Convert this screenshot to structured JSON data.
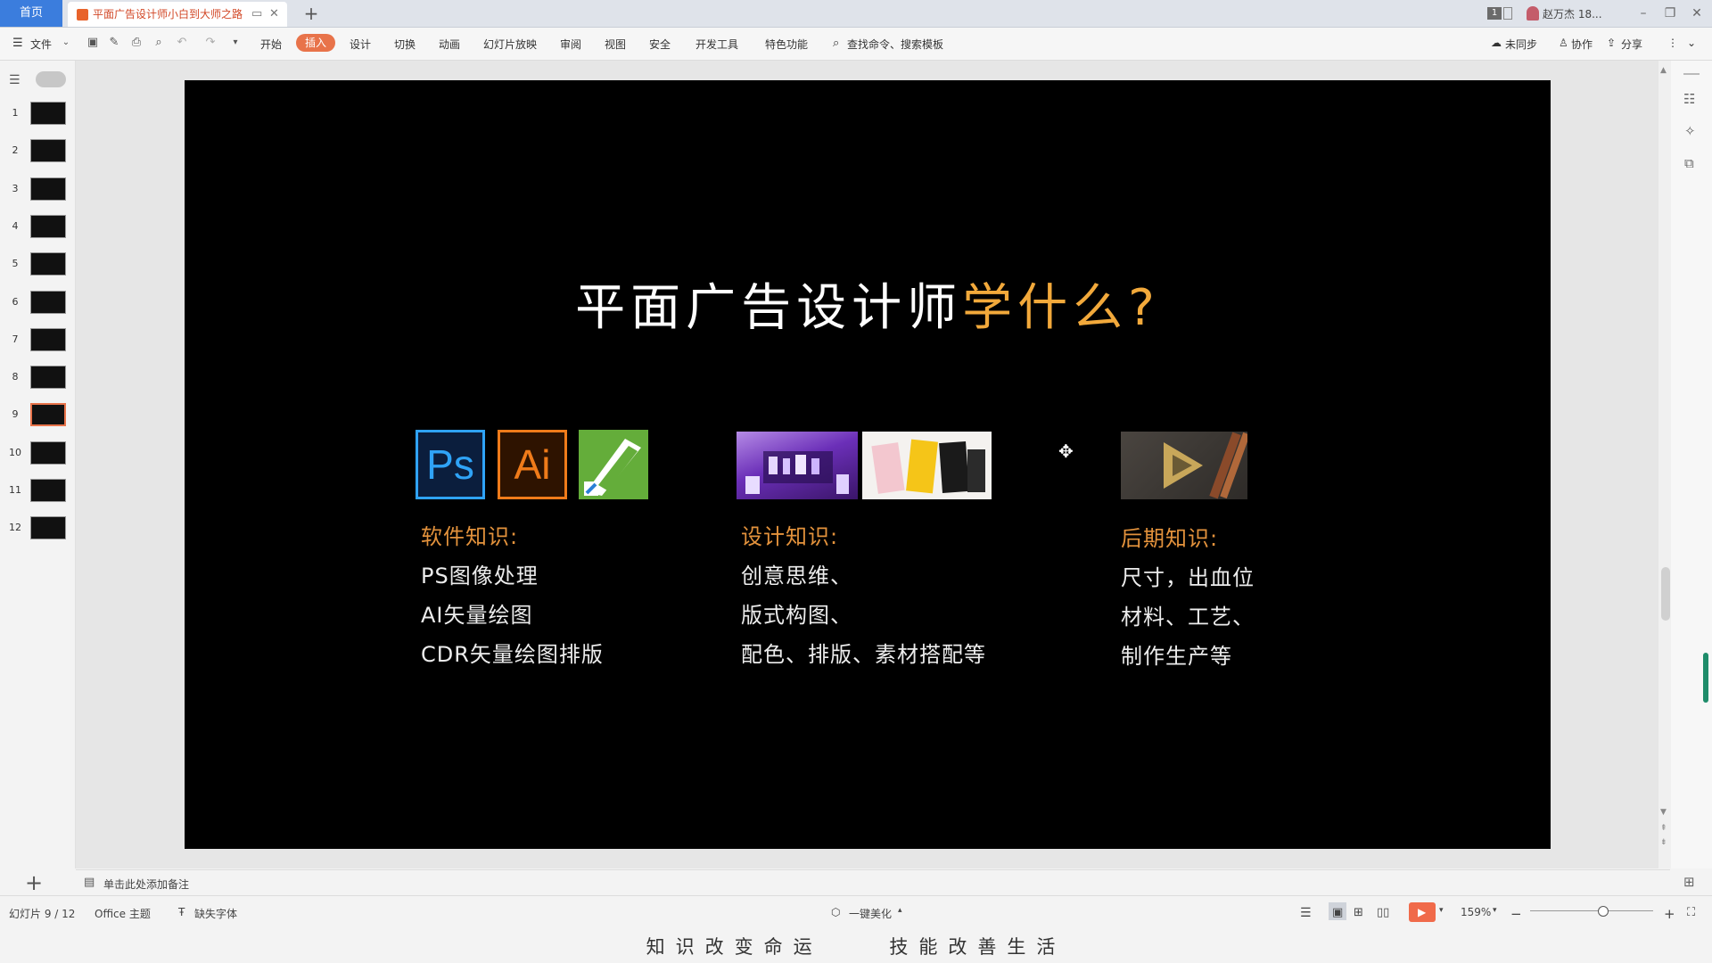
{
  "tabs": {
    "home": "首页",
    "doc_title": "平面广告设计师小白到大师之路",
    "add": "+"
  },
  "titlebar": {
    "page_badge": "1",
    "user_name": "赵万杰 18..."
  },
  "ribbon": {
    "file": "文件",
    "menus": [
      "开始",
      "插入",
      "设计",
      "切换",
      "动画",
      "幻灯片放映",
      "审阅",
      "视图",
      "安全",
      "开发工具",
      "特色功能"
    ],
    "search_placeholder": "查找命令、搜索模板",
    "sync": "未同步",
    "collab": "协作",
    "share": "分享"
  },
  "slides_panel": {
    "numbers": [
      "1",
      "2",
      "3",
      "4",
      "5",
      "6",
      "7",
      "8",
      "9",
      "10",
      "11",
      "12"
    ],
    "active": 9,
    "add_button": "+"
  },
  "slide": {
    "title_main": "平面广告设计师",
    "title_highlight": "学什么?",
    "logo_ps": "Ps",
    "logo_ai": "Ai",
    "col1": {
      "heading": "软件知识:",
      "lines": [
        "PS图像处理",
        "AI矢量绘图",
        "CDR矢量绘图排版"
      ]
    },
    "col2": {
      "heading": "设计知识:",
      "lines": [
        "创意思维、",
        "版式构图、",
        "配色、排版、素材搭配等"
      ]
    },
    "col3": {
      "heading": "后期知识:",
      "lines": [
        "尺寸，出血位",
        "材料、工艺、",
        "制作生产等"
      ]
    }
  },
  "notes": {
    "placeholder": "单击此处添加备注"
  },
  "status": {
    "slide_counter": "幻灯片 9 / 12",
    "theme": "Office 主题",
    "missing_font": "缺失字体",
    "beautify": "一键美化",
    "zoom": "159%"
  },
  "caption": "知识改变命运    技能改善生活",
  "colors": {
    "accent": "#e8734a",
    "title_highlight": "#f2a93b",
    "heading": "#e3923c"
  }
}
